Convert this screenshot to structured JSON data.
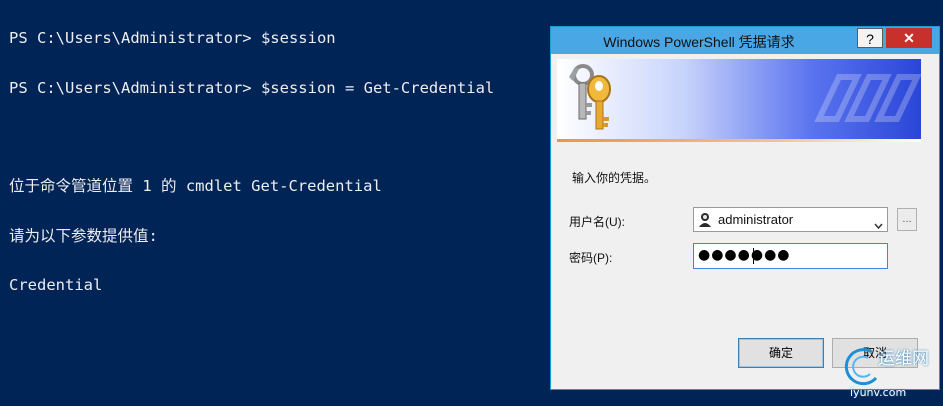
{
  "console": {
    "lines": [
      "PS C:\\Users\\Administrator> $session",
      "PS C:\\Users\\Administrator> $session = Get-Credential",
      "",
      "位于命令管道位置 1 的 cmdlet Get-Credential",
      "请为以下参数提供值:",
      "Credential"
    ]
  },
  "dialog": {
    "title": "Windows PowerShell 凭据请求",
    "help_label": "?",
    "close_label": "✕",
    "prompt": "输入你的凭据。",
    "username_label": "用户名(U):",
    "username_value": "administrator",
    "browse_label": "...",
    "password_label": "密码(P):",
    "password_mask": "●●●●●●●",
    "ok_label": "确定",
    "cancel_label": "取消"
  },
  "watermark": {
    "top": "运维网",
    "bottom": "iyunv.com"
  },
  "colors": {
    "console_bg": "#012456",
    "console_fg": "#eeedf0",
    "titlebar": "#4aa7e6",
    "close_button": "#c7302b"
  }
}
